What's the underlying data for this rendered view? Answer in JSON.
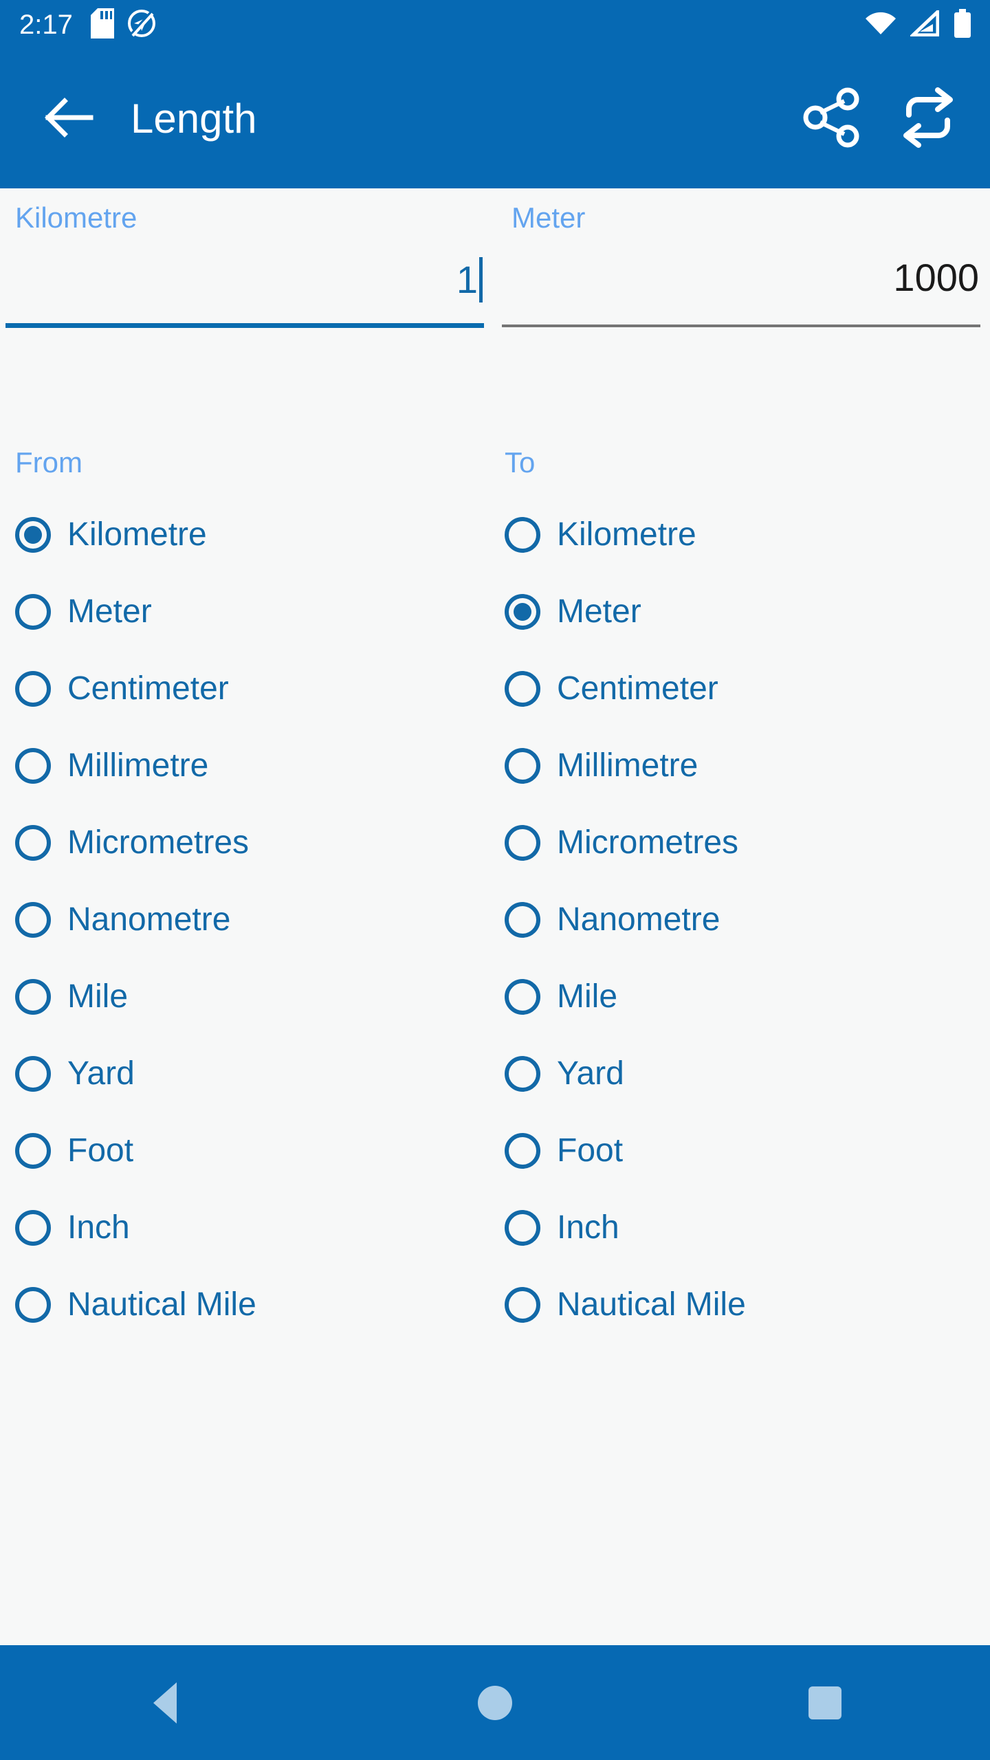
{
  "status_bar": {
    "clock": "2:17",
    "left_icons": [
      "sd-card-icon",
      "location-disabled-icon"
    ],
    "right_icons": [
      "wifi-icon",
      "cell-signal-icon",
      "battery-icon"
    ],
    "background_color": "#0669B3"
  },
  "app_bar": {
    "back_icon": "arrow-left-icon",
    "title": "Length",
    "actions": [
      {
        "icon": "share-icon",
        "label": "Share"
      },
      {
        "icon": "swap-icon",
        "label": "Swap units"
      }
    ],
    "background_color": "#0669B3",
    "title_color": "#FFFFFF"
  },
  "converter": {
    "source": {
      "label": "Kilometre",
      "value": "1",
      "placeholder": "0",
      "focused": true,
      "underline_color": "#0A6CAF",
      "value_color": "#1269A8"
    },
    "target": {
      "label": "Meter",
      "value": "1000",
      "placeholder": "0",
      "focused": false,
      "underline_color": "#757575",
      "value_color": "#1A1A1A"
    }
  },
  "columns": {
    "from": {
      "heading": "From",
      "selected": "Kilometre",
      "units": [
        "Kilometre",
        "Meter",
        "Centimeter",
        "Millimetre",
        "Micrometres",
        "Nanometre",
        "Mile",
        "Yard",
        "Foot",
        "Inch",
        "Nautical Mile"
      ]
    },
    "to": {
      "heading": "To",
      "selected": "Meter",
      "units": [
        "Kilometre",
        "Meter",
        "Centimeter",
        "Millimetre",
        "Micrometres",
        "Nanometre",
        "Mile",
        "Yard",
        "Foot",
        "Inch",
        "Nautical Mile"
      ]
    },
    "heading_color": "#63A4EF",
    "accent_color": "#1269A8"
  },
  "nav_bar": {
    "buttons": [
      {
        "icon": "nav-back-icon",
        "label": "Back"
      },
      {
        "icon": "nav-home-icon",
        "label": "Home"
      },
      {
        "icon": "nav-recents-icon",
        "label": "Recents"
      }
    ],
    "background_color": "#0669B3",
    "icon_color": "#AACDE8"
  },
  "theme": {
    "primary": "#0669B3",
    "accent": "#1269A8",
    "light_accent": "#63A4EF",
    "page_background": "#F7F8F8"
  }
}
